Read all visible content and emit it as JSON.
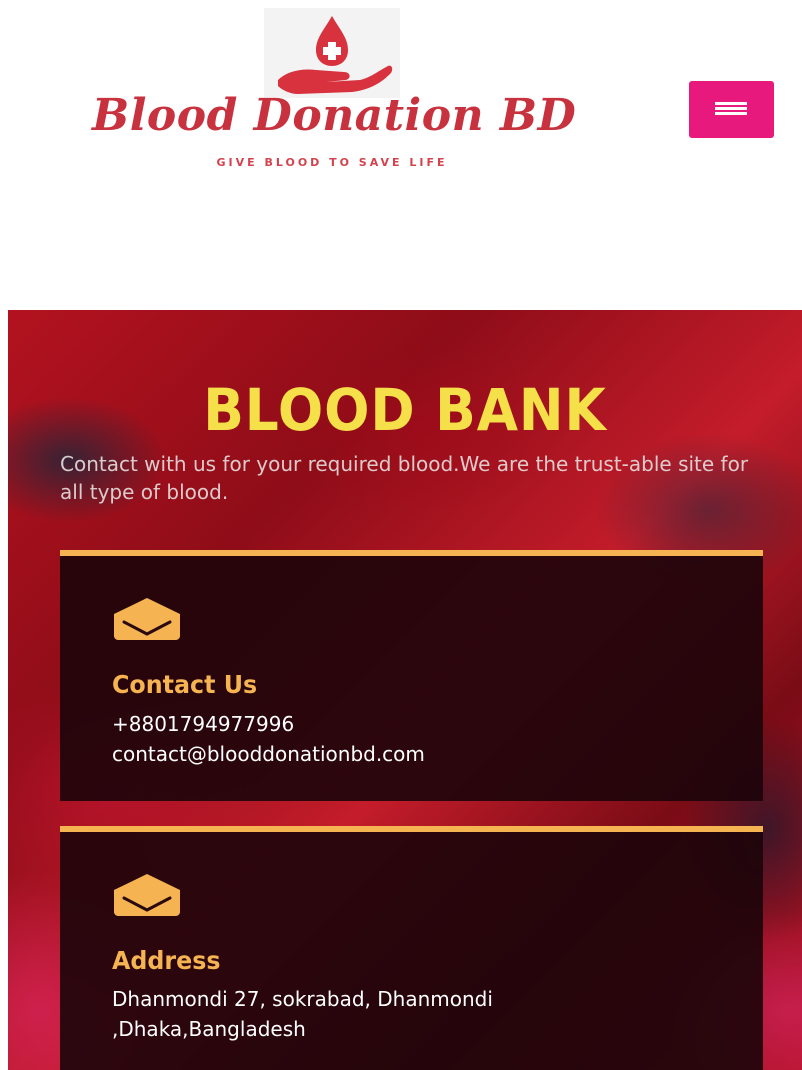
{
  "header": {
    "logo": {
      "name": "Blood Donation BD",
      "tagline": "GIVE BLOOD TO SAVE LIFE",
      "icon": "hand-holding-blood-drop-icon",
      "colors": {
        "primary": "#c8323e",
        "accent": "#d2434d"
      }
    },
    "menu_button": {
      "icon": "hamburger-menu-icon",
      "color": "#e8197c"
    }
  },
  "hero": {
    "title": "BLOOD BANK",
    "description": "Contact with us for your required blood.We are the trust-able site for all type of blood.",
    "colors": {
      "title": "#f5e04a",
      "card_accent": "#f5b451"
    }
  },
  "cards": [
    {
      "icon": "envelope-icon",
      "heading": "Contact Us",
      "lines": [
        "+8801794977996",
        "contact@blooddonationbd.com"
      ]
    },
    {
      "icon": "envelope-icon",
      "heading": "Address",
      "lines": [
        "Dhanmondi 27, sokrabad, Dhanmondi",
        ",Dhaka,Bangladesh"
      ]
    }
  ]
}
